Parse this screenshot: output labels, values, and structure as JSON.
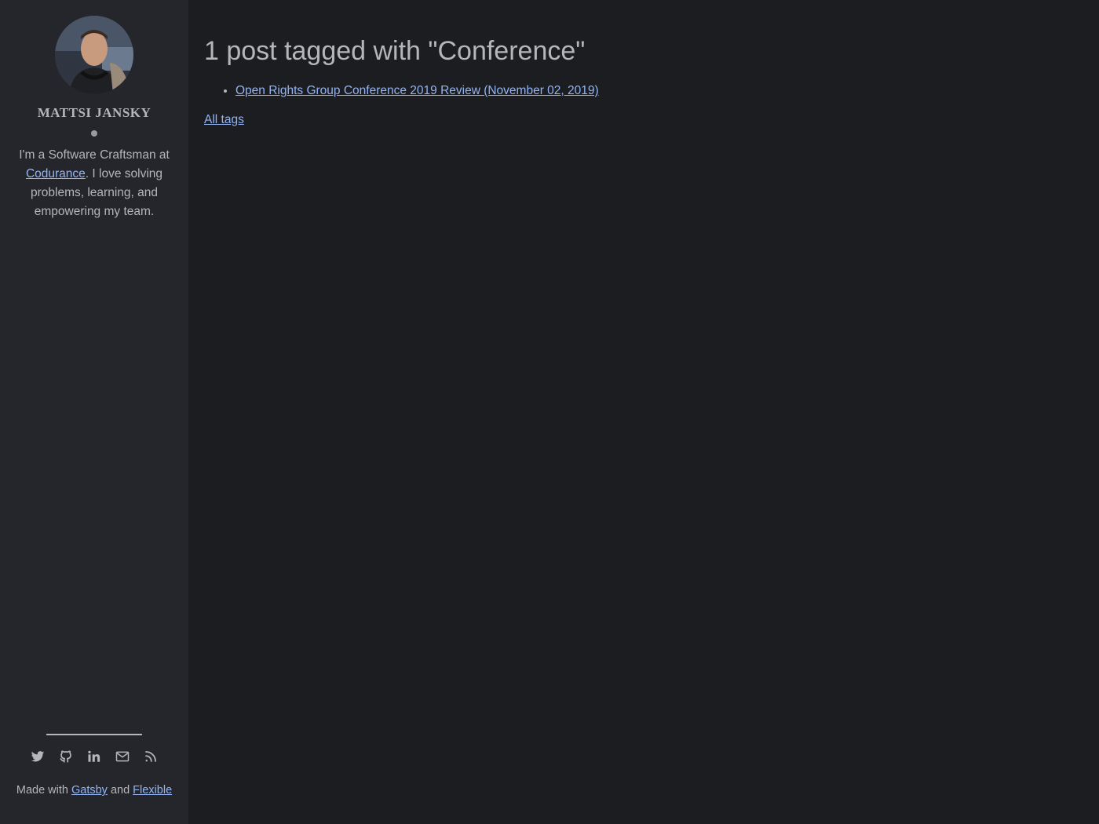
{
  "sidebar": {
    "author_name": "MATTSI JANSKY",
    "bio_prefix": "I'm a Software Craftsman at ",
    "bio_link": "Codurance",
    "bio_suffix": ". I love solving problems, learning, and empowering my team.",
    "socials": [
      {
        "icon": "twitter-icon"
      },
      {
        "icon": "github-icon"
      },
      {
        "icon": "linkedin-icon"
      },
      {
        "icon": "mail-icon"
      },
      {
        "icon": "rss-icon"
      }
    ],
    "footer_prefix": "Made with ",
    "footer_link1": "Gatsby",
    "footer_mid": " and ",
    "footer_link2": "Flexible"
  },
  "main": {
    "title": "1 post tagged with \"Conference\"",
    "posts": [
      {
        "label": "Open Rights Group Conference 2019 Review (November 02, 2019)"
      }
    ],
    "all_tags_label": "All tags"
  },
  "colors": {
    "background": "#1c1d21",
    "sidebar": "#25262b",
    "text": "#b4b6b9",
    "link": "#93b4f2"
  }
}
